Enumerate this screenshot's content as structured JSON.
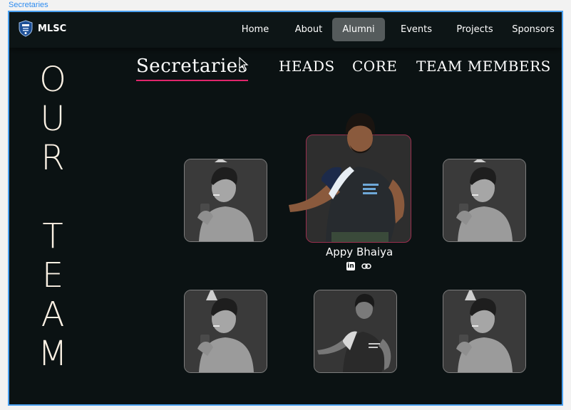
{
  "frame": {
    "label": "Secretaries"
  },
  "navbar": {
    "brand": "MLSC",
    "links": [
      {
        "label": "Home"
      },
      {
        "label": "About"
      },
      {
        "label": "Alumni",
        "active": true
      },
      {
        "label": "Events"
      },
      {
        "label": "Projects"
      },
      {
        "label": "Sponsors"
      }
    ]
  },
  "side_title": [
    "O",
    "U",
    "R",
    "",
    "T",
    "E",
    "A",
    "M"
  ],
  "tabs": [
    {
      "label": "Secretaries",
      "active": true
    },
    {
      "label": "HEADS"
    },
    {
      "label": "CORE"
    },
    {
      "label": "TEAM MEMBERS"
    }
  ],
  "featured_member": {
    "name": "Appy Bhaiya",
    "icons": [
      "linkedin-icon",
      "link-icon"
    ]
  },
  "colors": {
    "background": "#0b1213",
    "accent_underline": "#e0266b",
    "featured_border": "#9a2f4e",
    "title_text": "#fbf1e4",
    "active_nav_bg": "#555b5c"
  }
}
